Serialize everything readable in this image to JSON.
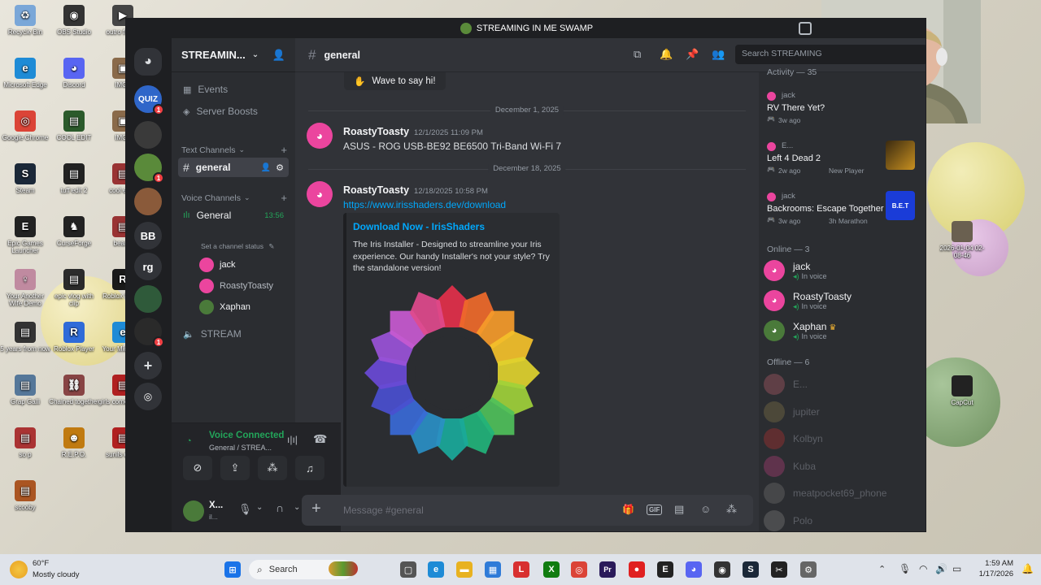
{
  "desktop": {
    "icons": [
      {
        "label": "Recycle Bin",
        "glyph": "♻",
        "color": "#7aa7d8"
      },
      {
        "label": "OBS Studio",
        "glyph": "◉",
        "color": "#333333"
      },
      {
        "label": "outro free (i",
        "glyph": "▶",
        "color": "#444444"
      },
      {
        "label": "Microsoft Edge",
        "glyph": "e",
        "color": "#1e8bd6"
      },
      {
        "label": "Discord",
        "glyph": "◕",
        "color": "#5865f2"
      },
      {
        "label": "IMG_",
        "glyph": "▣",
        "color": "#8a6a4a"
      },
      {
        "label": "Google Chrome",
        "glyph": "◎",
        "color": "#db4437"
      },
      {
        "label": "COOL EDIT",
        "glyph": "▤",
        "color": "#2b5a2b"
      },
      {
        "label": "IMG_",
        "glyph": "▣",
        "color": "#8a6a4a"
      },
      {
        "label": "Steam",
        "glyph": "S",
        "color": "#1b2838"
      },
      {
        "label": "tuff edit 2",
        "glyph": "▤",
        "color": "#222222"
      },
      {
        "label": "cool e vid",
        "glyph": "▤",
        "color": "#993333"
      },
      {
        "label": "Epic Games Launcher",
        "glyph": "E",
        "color": "#222222"
      },
      {
        "label": "CurseForge",
        "glyph": "♞",
        "color": "#222222"
      },
      {
        "label": "bear e",
        "glyph": "▤",
        "color": "#993333"
      },
      {
        "label": "Your Another Wife Demo",
        "glyph": "♀",
        "color": "#c08aa0"
      },
      {
        "label": "epic vlog with clip",
        "glyph": "▤",
        "color": "#2b2b2b"
      },
      {
        "label": "Roblox Studio",
        "glyph": "R",
        "color": "#1a1a1a"
      },
      {
        "label": "5 years from now",
        "glyph": "▤",
        "color": "#333333"
      },
      {
        "label": "Roblox Player",
        "glyph": "R",
        "color": "#2f6bd8"
      },
      {
        "label": "Your Microsoft",
        "glyph": "e",
        "color": "#1e8bd6"
      },
      {
        "label": "Grap Galli",
        "glyph": "▤",
        "color": "#557799"
      },
      {
        "label": "Chained together",
        "glyph": "⛓",
        "color": "#884444"
      },
      {
        "label": "girls come to wor",
        "glyph": "▤",
        "color": "#b02020"
      },
      {
        "label": "so p",
        "glyph": "▤",
        "color": "#aa3333"
      },
      {
        "label": "R.E.P.O.",
        "glyph": "☻",
        "color": "#c07a10"
      },
      {
        "label": "sunils down",
        "glyph": "▤",
        "color": "#b02020"
      },
      {
        "label": "scooby",
        "glyph": "▤",
        "color": "#aa5522"
      }
    ],
    "right_icons": [
      {
        "label": "2026-01-04 02-08-46"
      },
      {
        "label": "CapCut"
      }
    ]
  },
  "window": {
    "title": "STREAMING IN ME SWAMP"
  },
  "guilds": [
    {
      "label": "",
      "kind": "discord-home",
      "color": "#313338"
    },
    {
      "label": "QUIZ",
      "kind": "text",
      "color": "#2f66c9",
      "badge": "1"
    },
    {
      "label": "",
      "kind": "img",
      "color": "#3a3a3a"
    },
    {
      "label": "",
      "kind": "img",
      "color": "#5a8a3a",
      "badge": "1"
    },
    {
      "label": "",
      "kind": "img",
      "color": "#8a5a3a"
    },
    {
      "label": "BB",
      "kind": "text",
      "color": "#313338"
    },
    {
      "label": "rg",
      "kind": "text",
      "color": "#313338"
    },
    {
      "label": "",
      "kind": "img",
      "color": "#2f5a3a"
    },
    {
      "label": "",
      "kind": "img",
      "color": "#2a2a2a",
      "badge": "1"
    },
    {
      "label": "+",
      "kind": "add",
      "color": "#313338"
    },
    {
      "label": "◎",
      "kind": "discover",
      "color": "#313338"
    }
  ],
  "sidebar": {
    "server_name": "STREAMIN...",
    "items": [
      {
        "label": "Events"
      },
      {
        "label": "Server Boosts"
      }
    ],
    "text_category": "Text Channels",
    "text_channels": [
      {
        "label": "general"
      }
    ],
    "voice_category": "Voice Channels",
    "voice_channel": {
      "label": "General",
      "time": "13:56",
      "status": "Set a channel status"
    },
    "voice_users": [
      {
        "name": "jack",
        "color": "#eb459e"
      },
      {
        "name": "RoastyToasty",
        "color": "#eb459e"
      },
      {
        "name": "Xaphan",
        "color": "#4a7a3a"
      }
    ],
    "stream_channel": {
      "label": "STREAM"
    }
  },
  "voice_panel": {
    "status": "Voice Connected",
    "location": "General / STREA..."
  },
  "user_panel": {
    "name": "X...",
    "sub": "il..."
  },
  "chat": {
    "channel": "general",
    "search_placeholder": "Search STREAMING",
    "wave_label": "Wave to say hi!",
    "dividers": [
      "December 1, 2025",
      "December 18, 2025"
    ],
    "messages": [
      {
        "author": "RoastyToasty",
        "time": "12/1/2025 11:09 PM",
        "text": "ASUS - ROG USB-BE92 BE6500 Tri-Band Wi-Fi 7"
      },
      {
        "author": "RoastyToasty",
        "time": "12/18/2025 10:58 PM",
        "link": "https://www.irisshaders.dev/download"
      }
    ],
    "embed": {
      "title": "Download Now - IrisShaders",
      "description": "The Iris Installer - Designed to streamline your Iris experience. Our handy Installer's not your style? Try the standalone version!"
    },
    "composer_placeholder": "Message #general",
    "composer_icons": [
      "gift-icon",
      "gif-icon",
      "sticker-icon",
      "emoji-icon",
      "apps-icon"
    ]
  },
  "members": {
    "activity_header": "Activity — 35",
    "activities": [
      {
        "user": "jack",
        "title": "RV There Yet?",
        "meta": "3w ago"
      },
      {
        "user": "E...",
        "title": "Left 4 Dead 2",
        "meta": "2w ago",
        "extra": "New Player"
      },
      {
        "user": "jack",
        "title": "Backrooms: Escape Together",
        "meta": "3w ago",
        "extra": "3h Marathon",
        "thumb": "B.E.T"
      }
    ],
    "online_header": "Online — 3",
    "online": [
      {
        "name": "jack",
        "status": "In voice",
        "color": "#eb459e"
      },
      {
        "name": "RoastyToasty",
        "status": "In voice",
        "color": "#eb459e"
      },
      {
        "name": "Xaphan",
        "status": "In voice",
        "color": "#4a7a3a",
        "crown": "♛"
      }
    ],
    "offline_header": "Offline — 6",
    "offline": [
      {
        "name": "E...",
        "color": "#c06070"
      },
      {
        "name": "jupiter",
        "color": "#8a7a4a"
      },
      {
        "name": "Kolbyn",
        "color": "#c03030"
      },
      {
        "name": "Kuba",
        "color": "#c04080"
      },
      {
        "name": "meatpocket69_phone",
        "color": "#777777"
      },
      {
        "name": "Polo",
        "color": "#888888"
      }
    ]
  },
  "taskbar": {
    "weather_temp": "60°F",
    "weather_desc": "Mostly cloudy",
    "search_label": "Search",
    "time": "1:59 AM",
    "date": "1/17/2026",
    "apps": [
      {
        "name": "windows-start-icon",
        "glyph": "⊞",
        "color": "#1a73e8"
      },
      {
        "name": "task-view-icon",
        "glyph": "▢",
        "color": "#555555"
      },
      {
        "name": "edge-icon",
        "glyph": "e",
        "color": "#1e8bd6"
      },
      {
        "name": "file-explorer-icon",
        "glyph": "▬",
        "color": "#e8b220"
      },
      {
        "name": "store-icon",
        "glyph": "▦",
        "color": "#2f7bd8"
      },
      {
        "name": "l-app-icon",
        "glyph": "L",
        "color": "#d83030"
      },
      {
        "name": "xbox-icon",
        "glyph": "X",
        "color": "#107c10"
      },
      {
        "name": "chrome-icon",
        "glyph": "◎",
        "color": "#db4437"
      },
      {
        "name": "premiere-icon",
        "glyph": "Pr",
        "color": "#2a1a5a"
      },
      {
        "name": "red-app-icon",
        "glyph": "●",
        "color": "#e02020"
      },
      {
        "name": "epic-icon",
        "glyph": "E",
        "color": "#222222"
      },
      {
        "name": "discord-icon",
        "glyph": "◕",
        "color": "#5865f2"
      },
      {
        "name": "obs-icon",
        "glyph": "◉",
        "color": "#333333"
      },
      {
        "name": "steam-icon",
        "glyph": "S",
        "color": "#1b2838"
      },
      {
        "name": "capcut-icon",
        "glyph": "✂",
        "color": "#222222"
      },
      {
        "name": "settings-icon",
        "glyph": "⚙",
        "color": "#666666"
      }
    ]
  }
}
